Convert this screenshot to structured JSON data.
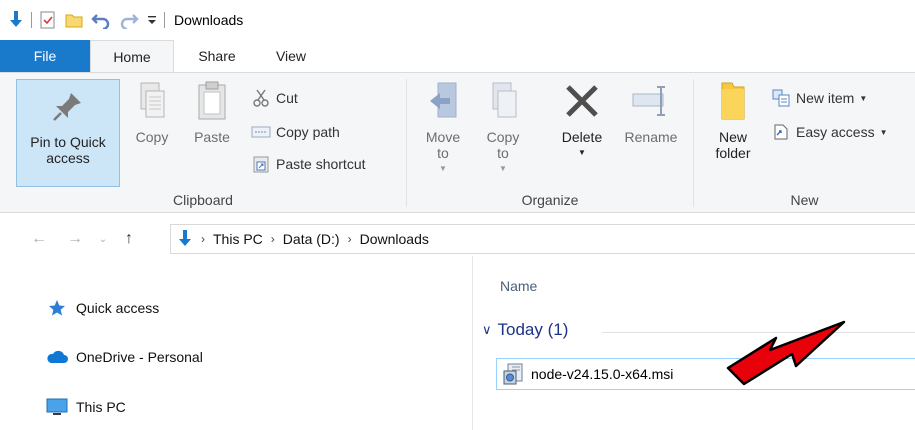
{
  "window": {
    "title": "Downloads"
  },
  "tabs": [
    {
      "label": "File"
    },
    {
      "label": "Home"
    },
    {
      "label": "Share"
    },
    {
      "label": "View"
    }
  ],
  "ribbon": {
    "clipboard": {
      "label": "Clipboard",
      "pin_label": "Pin to Quick access",
      "copy_label": "Copy",
      "paste_label": "Paste",
      "cut_label": "Cut",
      "copy_path_label": "Copy path",
      "paste_shortcut_label": "Paste shortcut"
    },
    "organize": {
      "label": "Organize",
      "move_to_label": "Move to",
      "copy_to_label": "Copy to",
      "delete_label": "Delete",
      "rename_label": "Rename"
    },
    "new": {
      "label": "New",
      "new_folder_label": "New folder",
      "new_item_label": "New item",
      "easy_access_label": "Easy access"
    }
  },
  "address": {
    "crumbs": [
      "This PC",
      "Data (D:)",
      "Downloads"
    ]
  },
  "nav": {
    "items": [
      {
        "label": "Quick access",
        "icon": "star-icon"
      },
      {
        "label": "OneDrive - Personal",
        "icon": "cloud-icon"
      },
      {
        "label": "This PC",
        "icon": "monitor-icon"
      }
    ]
  },
  "content": {
    "column_name": "Name",
    "group_label": "Today (1)",
    "files": [
      {
        "name": "node-v24.15.0-x64.msi",
        "icon": "msi-installer-icon"
      }
    ]
  },
  "colors": {
    "accent": "#1979ca",
    "annotation_arrow": "#e8000b"
  }
}
